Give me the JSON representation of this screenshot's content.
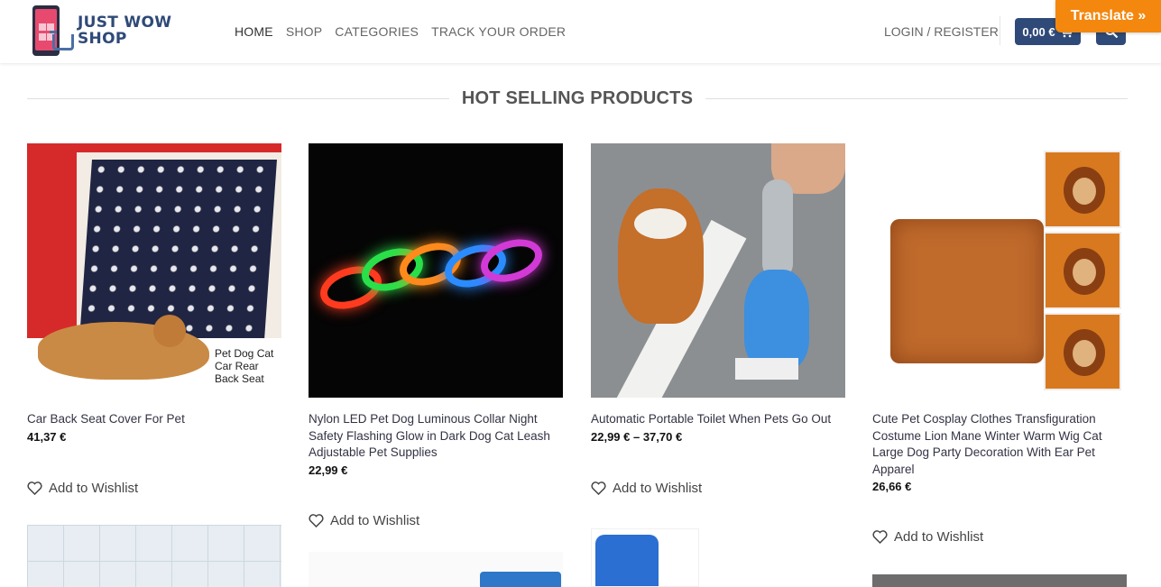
{
  "header": {
    "logo_line1": "JUST WOW",
    "logo_line2": "SHOP",
    "nav": [
      "HOME",
      "SHOP",
      "CATEGORIES",
      "TRACK YOUR ORDER"
    ],
    "login": "LOGIN / REGISTER",
    "cart_total": "0,00 €",
    "translate": "Translate »"
  },
  "colors": {
    "brand": "#2f4a78",
    "translate": "#f4870e"
  },
  "section_title": "HOT SELLING PRODUCTS",
  "products": [
    {
      "name": "Car Back Seat Cover For Pet",
      "price": "41,37 €",
      "wishlist": "Add to Wishlist",
      "image_caption": "Pet Dog Cat Car Rear Back Seat"
    },
    {
      "name": "Nylon LED Pet Dog Luminous Collar Night Safety Flashing Glow in Dark Dog Cat Leash Adjustable Pet Supplies",
      "price": "22,99 €",
      "wishlist": "Add to Wishlist"
    },
    {
      "name": "Automatic Portable Toilet When Pets Go Out",
      "price": "22,99 € – 37,70 €",
      "wishlist": "Add to Wishlist"
    },
    {
      "name": "Cute Pet Cosplay Clothes Transfiguration Costume Lion Mane Winter Warm Wig Cat Large Dog Party Decoration With Ear Pet Apparel",
      "price": "26,66 €",
      "wishlist": "Add to Wishlist"
    }
  ]
}
